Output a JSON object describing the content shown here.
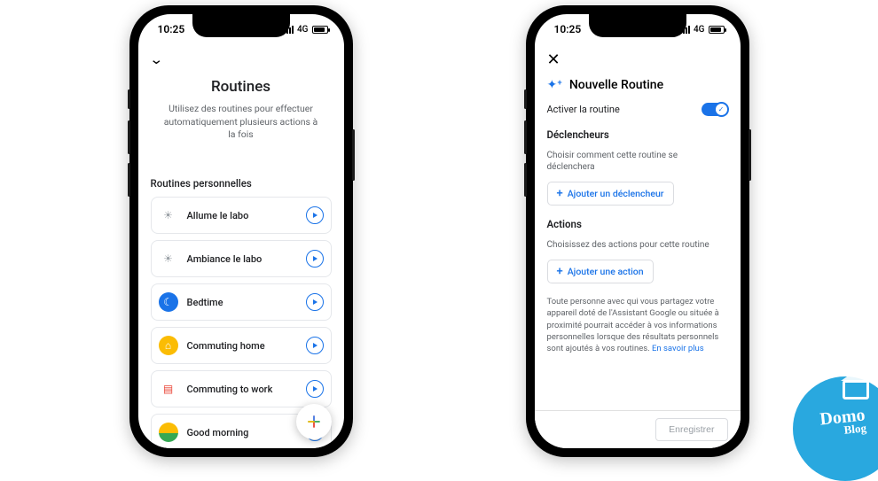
{
  "status": {
    "time": "10:25",
    "net": "4G"
  },
  "left": {
    "title": "Routines",
    "subtitle": "Utilisez des routines pour effectuer automatiquement plusieurs actions à la fois",
    "section_label": "Routines personnelles",
    "items": [
      {
        "label": "Allume le labo",
        "icon": "sun"
      },
      {
        "label": "Ambiance le labo",
        "icon": "sun"
      },
      {
        "label": "Bedtime",
        "icon": "moon"
      },
      {
        "label": "Commuting home",
        "icon": "home"
      },
      {
        "label": "Commuting to work",
        "icon": "work"
      },
      {
        "label": "Good morning",
        "icon": "morn"
      }
    ]
  },
  "right": {
    "title": "Nouvelle Routine",
    "activate_label": "Activer la routine",
    "triggers_heading": "Déclencheurs",
    "triggers_hint": "Choisir comment cette routine se déclenchera",
    "add_trigger": "Ajouter un déclencheur",
    "actions_heading": "Actions",
    "actions_hint": "Choisissez des actions pour cette routine",
    "add_action": "Ajouter une action",
    "footnote": "Toute personne avec qui vous partagez votre appareil doté de l'Assistant Google ou située à proximité pourrait accéder à vos informations personnelles lorsque des résultats personnels sont ajoutés à vos routines.",
    "learn_more": "En savoir plus",
    "save": "Enregistrer"
  },
  "watermark": {
    "line1": "Domo",
    "line2": "Blog"
  }
}
